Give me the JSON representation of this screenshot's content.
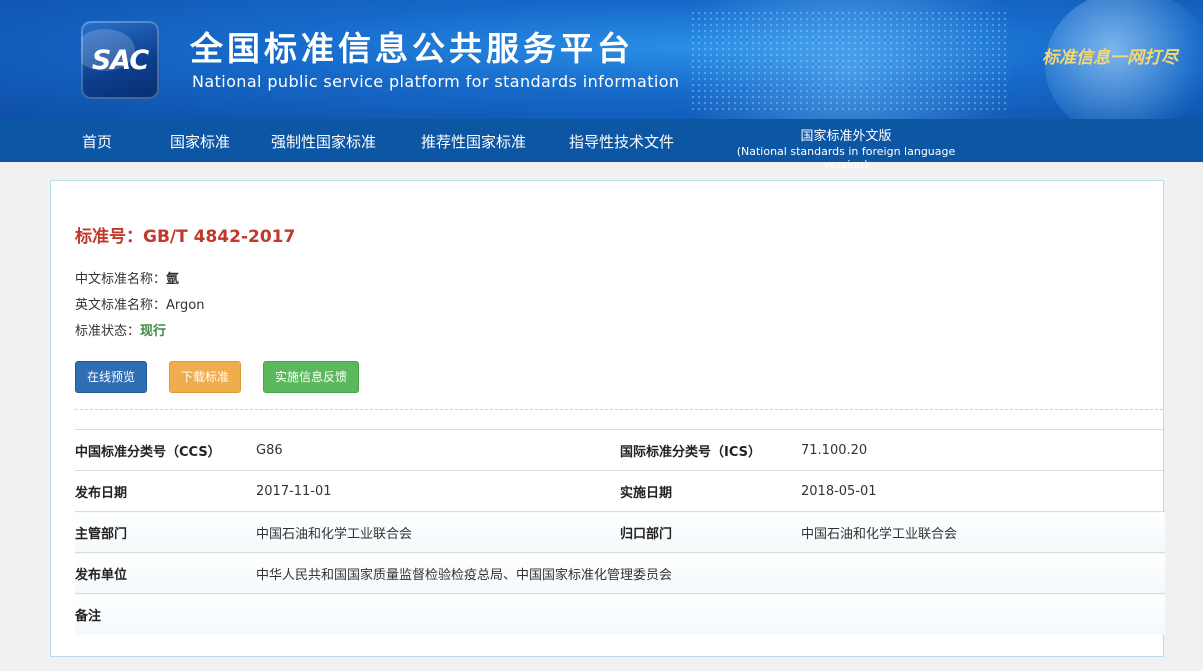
{
  "header": {
    "logo_text": "SAC",
    "title": "全国标准信息公共服务平台",
    "subtitle": "National public service platform  for standards information",
    "slogan": "标准信息一网打尽"
  },
  "nav": {
    "items": [
      "首页",
      "国家标准",
      "强制性国家标准",
      "推荐性国家标准",
      "指导性技术文件"
    ],
    "foreign_line1": "国家标准外文版",
    "foreign_line2": "(National standards in foreign language version)"
  },
  "standard": {
    "number_label": "标准号：",
    "number": "GB/T 4842-2017",
    "cn_name_label": "中文标准名称：",
    "cn_name": "氩",
    "en_name_label": "英文标准名称：",
    "en_name": "Argon",
    "status_label": "标准状态：",
    "status": "现行"
  },
  "buttons": {
    "preview": "在线预览",
    "download": "下载标准",
    "feedback": "实施信息反馈"
  },
  "details": {
    "ccs_label": "中国标准分类号（CCS）",
    "ccs": "G86",
    "ics_label": "国际标准分类号（ICS）",
    "ics": "71.100.20",
    "publish_date_label": "发布日期",
    "publish_date": "2017-11-01",
    "impl_date_label": "实施日期",
    "impl_date": "2018-05-01",
    "dept_label": "主管部门",
    "dept": "中国石油和化学工业联合会",
    "owner_label": "归口部门",
    "owner": "中国石油和化学工业联合会",
    "publisher_label": "发布单位",
    "publisher": "中华人民共和国国家质量监督检验检疫总局、中国国家标准化管理委员会",
    "remark_label": "备注",
    "remark": ""
  },
  "colors": {
    "header_blue": "#1669c9",
    "nav_blue": "#0c56a4",
    "std_number_red": "#c0392b",
    "status_green": "#3b8a3b",
    "btn_preview": "#2f6db5",
    "btn_download": "#f0ad4e",
    "btn_feedback": "#5cb85c"
  }
}
